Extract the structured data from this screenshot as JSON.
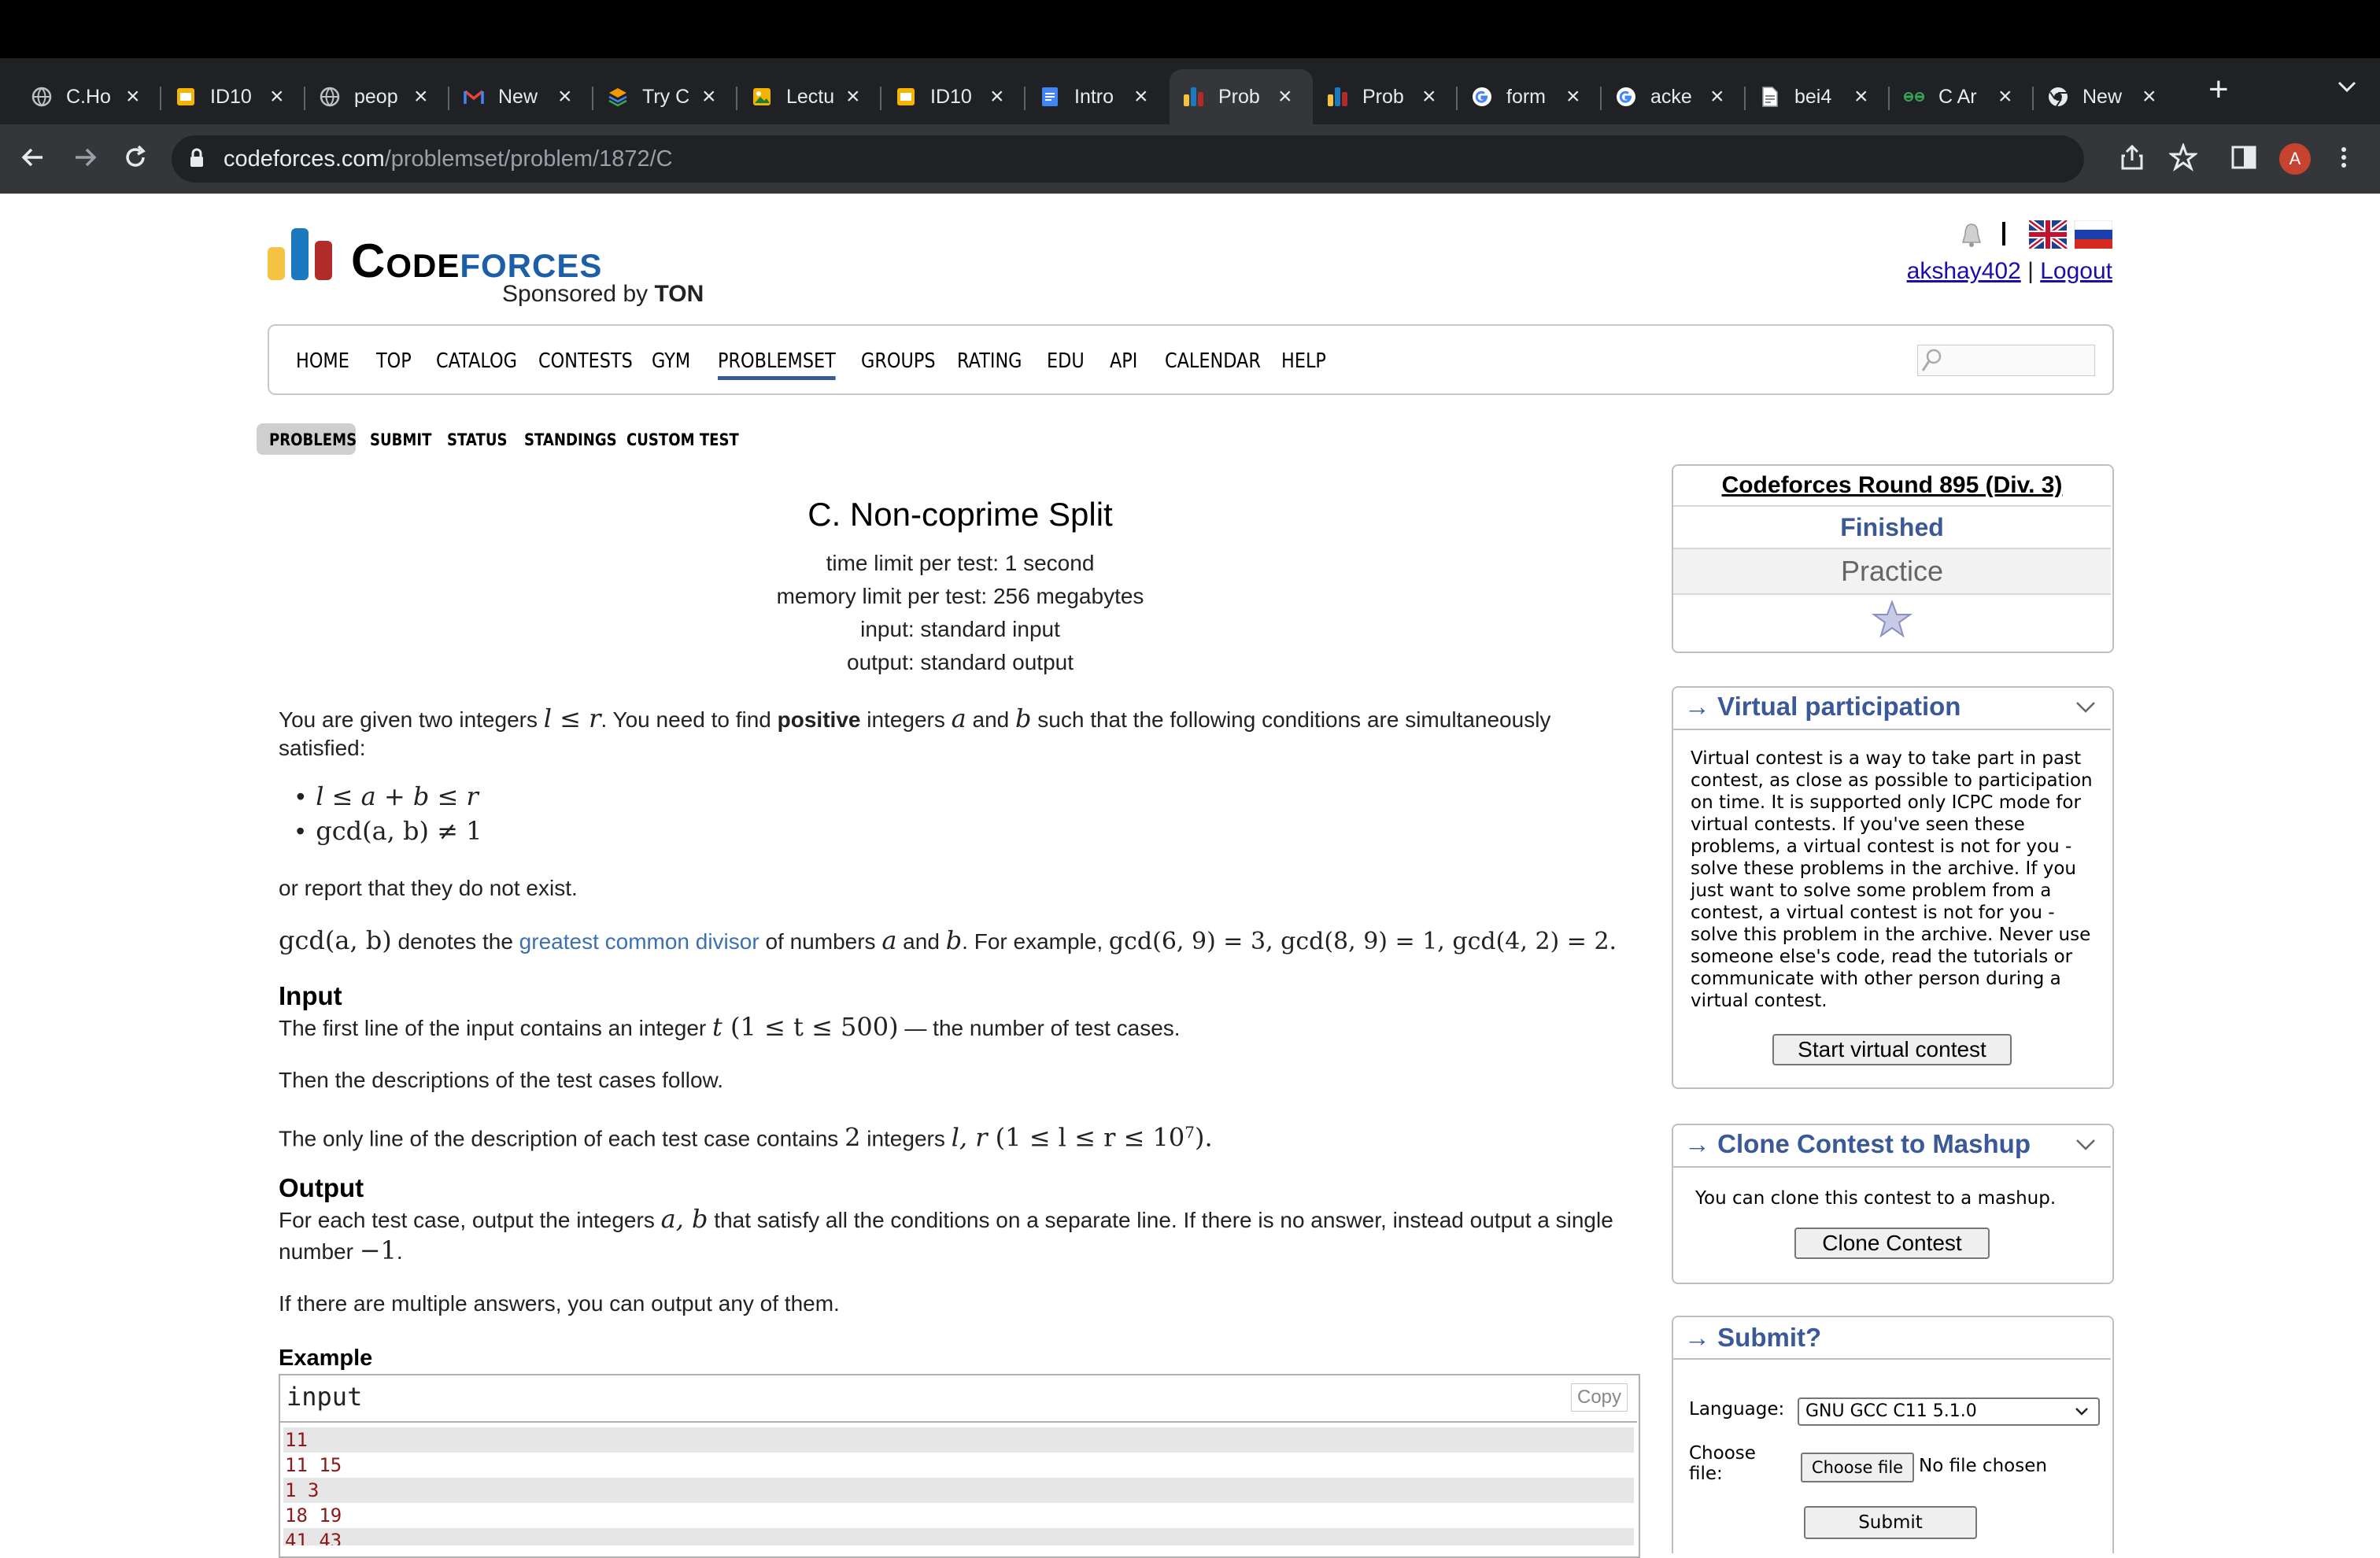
{
  "browser": {
    "tabs": [
      {
        "title": "C.Ho",
        "icon": "globe-icon"
      },
      {
        "title": "ID10",
        "icon": "slides-icon"
      },
      {
        "title": "peop",
        "icon": "globe-icon"
      },
      {
        "title": "New",
        "icon": "gmail-icon"
      },
      {
        "title": "Try C",
        "icon": "layers-icon"
      },
      {
        "title": "Lectu",
        "icon": "image-icon"
      },
      {
        "title": "ID10",
        "icon": "slides-icon"
      },
      {
        "title": "Intro",
        "icon": "docs-icon"
      },
      {
        "title": "Prob",
        "icon": "codeforces-icon",
        "active": true
      },
      {
        "title": "Prob",
        "icon": "codeforces-icon"
      },
      {
        "title": "form",
        "icon": "google-icon"
      },
      {
        "title": "acke",
        "icon": "google-icon"
      },
      {
        "title": "bei4",
        "icon": "document-icon"
      },
      {
        "title": "C Ar",
        "icon": "link-icon"
      },
      {
        "title": "New",
        "icon": "chrome-icon"
      }
    ],
    "url_host": "codeforces.com",
    "url_path": "/problemset/problem/1872/C",
    "avatar_letter": "A"
  },
  "header": {
    "logo_text_1": "Code",
    "logo_text_2": "forces",
    "sponsor_prefix": "Sponsored by",
    "sponsor_name": "TON",
    "username": "akshay402",
    "separator": "|",
    "logout": "Logout"
  },
  "menu": [
    "HOME",
    "TOP",
    "CATALOG",
    "CONTESTS",
    "GYM",
    "PROBLEMSET",
    "GROUPS",
    "RATING",
    "EDU",
    "API",
    "CALENDAR",
    "HELP"
  ],
  "subnav": [
    "PROBLEMS",
    "SUBMIT",
    "STATUS",
    "STANDINGS",
    "CUSTOM TEST"
  ],
  "problem": {
    "title": "C. Non-coprime Split",
    "time_limit": "time limit per test: 1 second",
    "memory_limit": "memory limit per test: 256 megabytes",
    "input": "input: standard input",
    "output": "output: standard output",
    "s1a": "You are given two integers ",
    "s1m1": "l ≤ r",
    "s1b": ". You need to find ",
    "s1bold": "positive",
    "s1c": " integers ",
    "s1m2": "a",
    "s1d": " and ",
    "s1m3": "b",
    "s1e": " such that the following conditions are simultaneously",
    "s1f": "satisfied:",
    "cond1": "l ≤ a + b ≤ r",
    "cond2": "gcd(a, b) ≠ 1",
    "s2": "or report that they do not exist.",
    "s3m": "gcd(a, b)",
    "s3a": " denotes the ",
    "s3link": "greatest common divisor",
    "s3b": " of numbers ",
    "s3m2": "a",
    "s3c": " and ",
    "s3m3": "b",
    "s3d": ". For example, ",
    "s3m4": "gcd(6, 9) = 3, gcd(8, 9) = 1, gcd(4, 2) = 2.",
    "input_heading": "Input",
    "in1a": "The first line of the input contains an integer ",
    "in1m": "t",
    "in1m2": " (1 ≤ t ≤ 500)",
    "in1b": " — the number of test cases.",
    "in2": "Then the descriptions of the test cases follow.",
    "in3a": "The only line of the description of each test case contains ",
    "in3m": "2",
    "in3b": " integers ",
    "in3m2": "l, r",
    "in3m3": " (1 ≤ l ≤ r ≤ 10",
    "in3sup": "7",
    "in3end": ").",
    "output_heading": "Output",
    "out1a": "For each test case, output the integers ",
    "out1m": "a, b",
    "out1b": " that satisfy all the conditions on a separate line. If there is no answer, instead output a single",
    "out1c": "number ",
    "out1m2": "−1",
    "out1d": ".",
    "out2": "If there are multiple answers, you can output any of them.",
    "example_heading": "Example",
    "example_input_label": "input",
    "copy_label": "Copy",
    "example_lines": [
      "11",
      "11 15",
      "1 3",
      "18 19",
      "41 43"
    ]
  },
  "sidebar": {
    "round_name": "Codeforces Round 895 (Div. 3)",
    "round_status": "Finished",
    "round_mode": "Practice",
    "virtual_heading": "→ Virtual participation",
    "virtual_text": "Virtual contest is a way to take part in past contest, as close as possible to participation on time. It is supported only ICPC mode for virtual contests. If you've seen these problems, a virtual contest is not for you - solve these problems in the archive. If you just want to solve some problem from a contest, a virtual contest is not for you - solve this problem in the archive. Never use someone else's code, read the tutorials or communicate with other person during a virtual contest.",
    "virtual_button": "Start virtual contest",
    "clone_heading": "→ Clone Contest to Mashup",
    "clone_text": "You can clone this contest to a mashup.",
    "clone_button": "Clone Contest",
    "submit_heading": "→ Submit?",
    "language_label": "Language:",
    "language_value": "GNU GCC C11 5.1.0",
    "file_label": "Choose file:",
    "file_button": "Choose file",
    "file_status": "No file chosen",
    "submit_button": "Submit"
  }
}
